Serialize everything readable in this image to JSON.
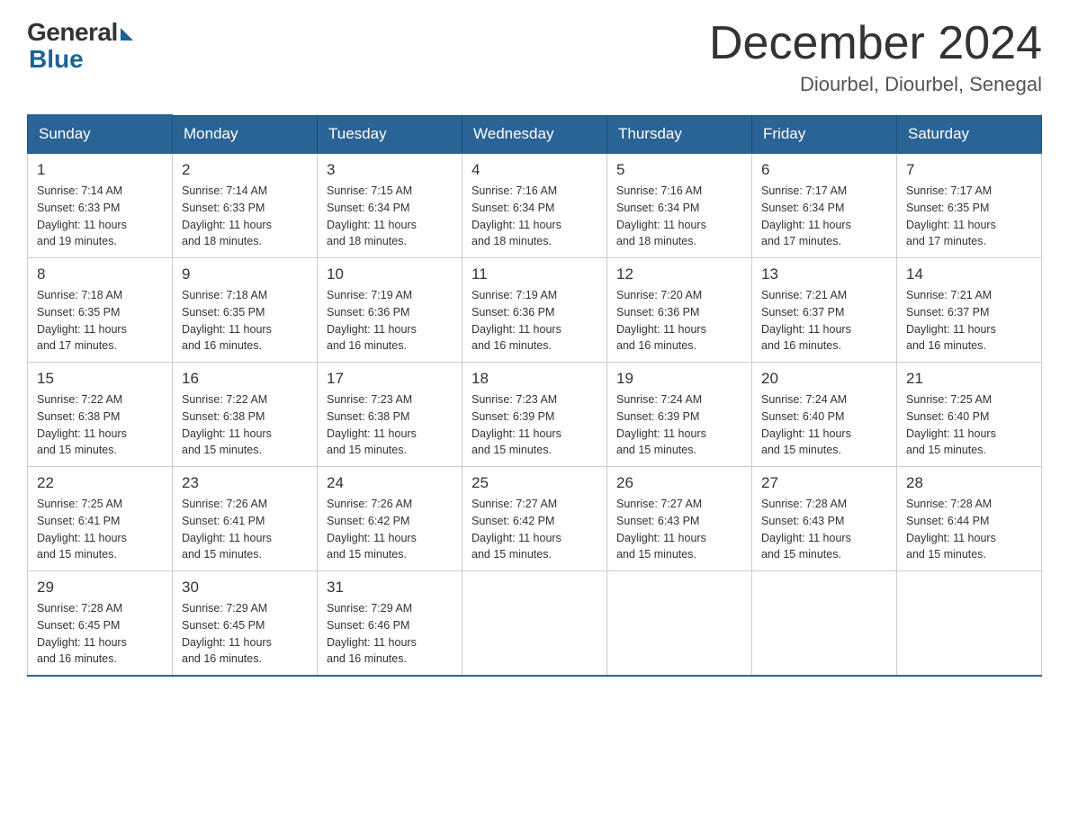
{
  "header": {
    "logo_general": "General",
    "logo_blue": "Blue",
    "month_year": "December 2024",
    "location": "Diourbel, Diourbel, Senegal"
  },
  "days_of_week": [
    "Sunday",
    "Monday",
    "Tuesday",
    "Wednesday",
    "Thursday",
    "Friday",
    "Saturday"
  ],
  "weeks": [
    [
      {
        "day": "1",
        "sunrise": "7:14 AM",
        "sunset": "6:33 PM",
        "daylight": "11 hours and 19 minutes."
      },
      {
        "day": "2",
        "sunrise": "7:14 AM",
        "sunset": "6:33 PM",
        "daylight": "11 hours and 18 minutes."
      },
      {
        "day": "3",
        "sunrise": "7:15 AM",
        "sunset": "6:34 PM",
        "daylight": "11 hours and 18 minutes."
      },
      {
        "day": "4",
        "sunrise": "7:16 AM",
        "sunset": "6:34 PM",
        "daylight": "11 hours and 18 minutes."
      },
      {
        "day": "5",
        "sunrise": "7:16 AM",
        "sunset": "6:34 PM",
        "daylight": "11 hours and 18 minutes."
      },
      {
        "day": "6",
        "sunrise": "7:17 AM",
        "sunset": "6:34 PM",
        "daylight": "11 hours and 17 minutes."
      },
      {
        "day": "7",
        "sunrise": "7:17 AM",
        "sunset": "6:35 PM",
        "daylight": "11 hours and 17 minutes."
      }
    ],
    [
      {
        "day": "8",
        "sunrise": "7:18 AM",
        "sunset": "6:35 PM",
        "daylight": "11 hours and 17 minutes."
      },
      {
        "day": "9",
        "sunrise": "7:18 AM",
        "sunset": "6:35 PM",
        "daylight": "11 hours and 16 minutes."
      },
      {
        "day": "10",
        "sunrise": "7:19 AM",
        "sunset": "6:36 PM",
        "daylight": "11 hours and 16 minutes."
      },
      {
        "day": "11",
        "sunrise": "7:19 AM",
        "sunset": "6:36 PM",
        "daylight": "11 hours and 16 minutes."
      },
      {
        "day": "12",
        "sunrise": "7:20 AM",
        "sunset": "6:36 PM",
        "daylight": "11 hours and 16 minutes."
      },
      {
        "day": "13",
        "sunrise": "7:21 AM",
        "sunset": "6:37 PM",
        "daylight": "11 hours and 16 minutes."
      },
      {
        "day": "14",
        "sunrise": "7:21 AM",
        "sunset": "6:37 PM",
        "daylight": "11 hours and 16 minutes."
      }
    ],
    [
      {
        "day": "15",
        "sunrise": "7:22 AM",
        "sunset": "6:38 PM",
        "daylight": "11 hours and 15 minutes."
      },
      {
        "day": "16",
        "sunrise": "7:22 AM",
        "sunset": "6:38 PM",
        "daylight": "11 hours and 15 minutes."
      },
      {
        "day": "17",
        "sunrise": "7:23 AM",
        "sunset": "6:38 PM",
        "daylight": "11 hours and 15 minutes."
      },
      {
        "day": "18",
        "sunrise": "7:23 AM",
        "sunset": "6:39 PM",
        "daylight": "11 hours and 15 minutes."
      },
      {
        "day": "19",
        "sunrise": "7:24 AM",
        "sunset": "6:39 PM",
        "daylight": "11 hours and 15 minutes."
      },
      {
        "day": "20",
        "sunrise": "7:24 AM",
        "sunset": "6:40 PM",
        "daylight": "11 hours and 15 minutes."
      },
      {
        "day": "21",
        "sunrise": "7:25 AM",
        "sunset": "6:40 PM",
        "daylight": "11 hours and 15 minutes."
      }
    ],
    [
      {
        "day": "22",
        "sunrise": "7:25 AM",
        "sunset": "6:41 PM",
        "daylight": "11 hours and 15 minutes."
      },
      {
        "day": "23",
        "sunrise": "7:26 AM",
        "sunset": "6:41 PM",
        "daylight": "11 hours and 15 minutes."
      },
      {
        "day": "24",
        "sunrise": "7:26 AM",
        "sunset": "6:42 PM",
        "daylight": "11 hours and 15 minutes."
      },
      {
        "day": "25",
        "sunrise": "7:27 AM",
        "sunset": "6:42 PM",
        "daylight": "11 hours and 15 minutes."
      },
      {
        "day": "26",
        "sunrise": "7:27 AM",
        "sunset": "6:43 PM",
        "daylight": "11 hours and 15 minutes."
      },
      {
        "day": "27",
        "sunrise": "7:28 AM",
        "sunset": "6:43 PM",
        "daylight": "11 hours and 15 minutes."
      },
      {
        "day": "28",
        "sunrise": "7:28 AM",
        "sunset": "6:44 PM",
        "daylight": "11 hours and 15 minutes."
      }
    ],
    [
      {
        "day": "29",
        "sunrise": "7:28 AM",
        "sunset": "6:45 PM",
        "daylight": "11 hours and 16 minutes."
      },
      {
        "day": "30",
        "sunrise": "7:29 AM",
        "sunset": "6:45 PM",
        "daylight": "11 hours and 16 minutes."
      },
      {
        "day": "31",
        "sunrise": "7:29 AM",
        "sunset": "6:46 PM",
        "daylight": "11 hours and 16 minutes."
      },
      null,
      null,
      null,
      null
    ]
  ],
  "labels": {
    "sunrise": "Sunrise:",
    "sunset": "Sunset:",
    "daylight": "Daylight:"
  }
}
